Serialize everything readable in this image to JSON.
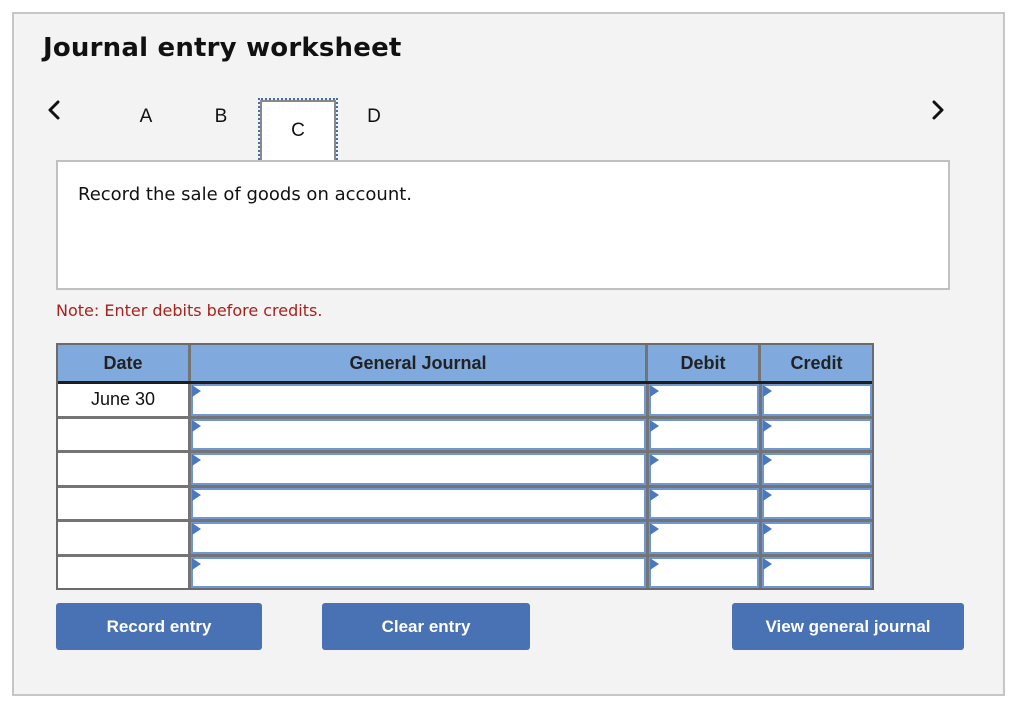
{
  "header": {
    "title": "Journal entry worksheet"
  },
  "navigation": {
    "prev_icon": "chevron-left-icon",
    "next_icon": "chevron-right-icon",
    "tabs": [
      {
        "label": "A",
        "active": false
      },
      {
        "label": "B",
        "active": false
      },
      {
        "label": "C",
        "active": true
      },
      {
        "label": "D",
        "active": false
      }
    ]
  },
  "prompt": {
    "text": "Record the sale of goods on account."
  },
  "note": {
    "text": "Note: Enter debits before credits."
  },
  "journal": {
    "columns": [
      "Date",
      "General Journal",
      "Debit",
      "Credit"
    ],
    "rows": [
      {
        "date": "June 30",
        "account": "",
        "debit": "",
        "credit": ""
      },
      {
        "date": "",
        "account": "",
        "debit": "",
        "credit": ""
      },
      {
        "date": "",
        "account": "",
        "debit": "",
        "credit": ""
      },
      {
        "date": "",
        "account": "",
        "debit": "",
        "credit": ""
      },
      {
        "date": "",
        "account": "",
        "debit": "",
        "credit": ""
      },
      {
        "date": "",
        "account": "",
        "debit": "",
        "credit": ""
      }
    ]
  },
  "buttons": {
    "record": "Record entry",
    "clear": "Clear entry",
    "view": "View general journal"
  },
  "colors": {
    "button": "#4872b3",
    "header": "#80a9de",
    "note": "#a8221c",
    "input_border": "#6f98d3"
  }
}
